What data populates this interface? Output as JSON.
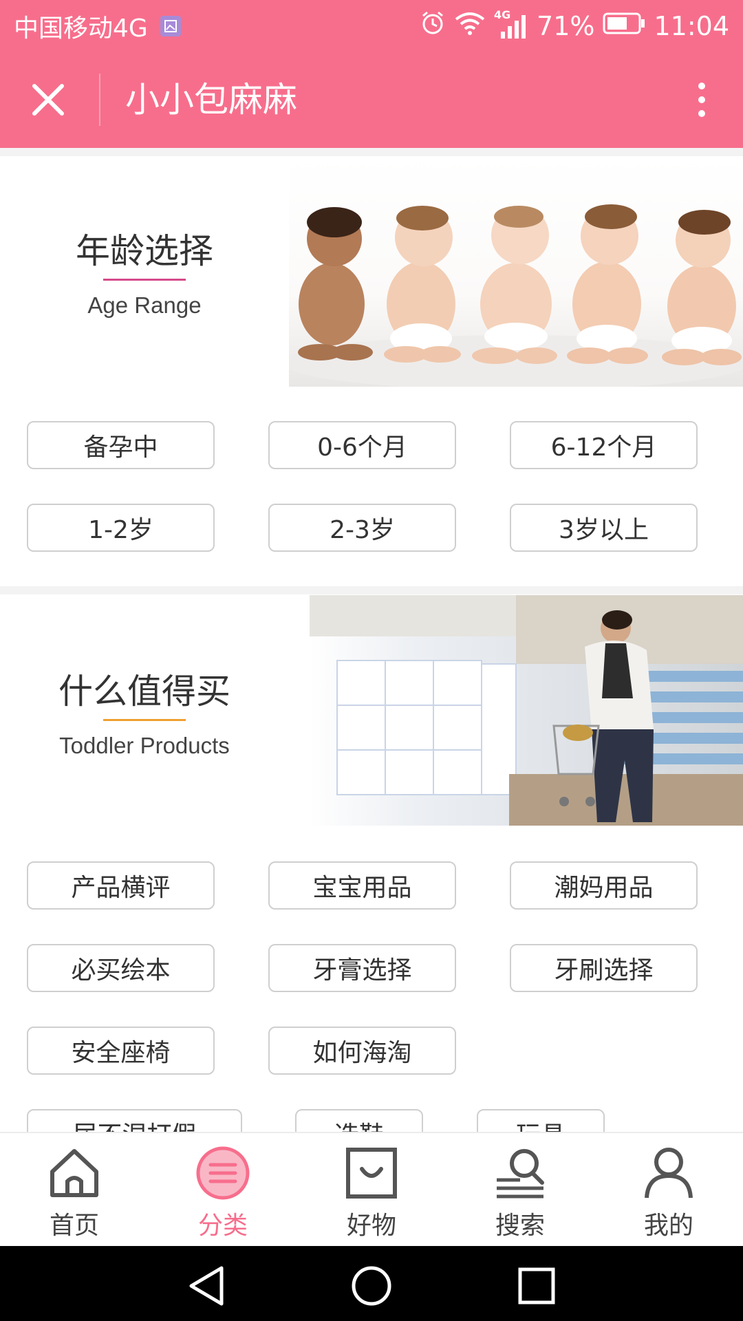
{
  "status_bar": {
    "carrier": "中国移动4G",
    "network_badge": "4G",
    "battery_percent": "71%",
    "time": "11:04"
  },
  "title_bar": {
    "title": "小小包麻麻"
  },
  "age_section": {
    "title": "年龄选择",
    "subtitle": "Age Range",
    "underline_color": "#d44a8a",
    "buttons": [
      "备孕中",
      "0-6个月",
      "6-12个月",
      "1-2岁",
      "2-3岁",
      "3岁以上"
    ]
  },
  "products_section": {
    "title": "什么值得买",
    "subtitle": "Toddler Products",
    "underline_color": "#f0a030",
    "buttons": [
      "产品横评",
      "宝宝用品",
      "潮妈用品",
      "必买绘本",
      "牙膏选择",
      "牙刷选择",
      "安全座椅",
      "如何海淘"
    ],
    "partial_row": [
      "尿不湿打假",
      "选鞋",
      "玩具"
    ]
  },
  "bottom_nav": {
    "items": [
      {
        "label": "首页",
        "icon": "home-icon"
      },
      {
        "label": "分类",
        "icon": "category-icon",
        "active": true
      },
      {
        "label": "好物",
        "icon": "shopping-bag-icon"
      },
      {
        "label": "搜索",
        "icon": "search-icon"
      },
      {
        "label": "我的",
        "icon": "profile-icon"
      }
    ]
  },
  "colors": {
    "accent": "#f76e8c"
  }
}
